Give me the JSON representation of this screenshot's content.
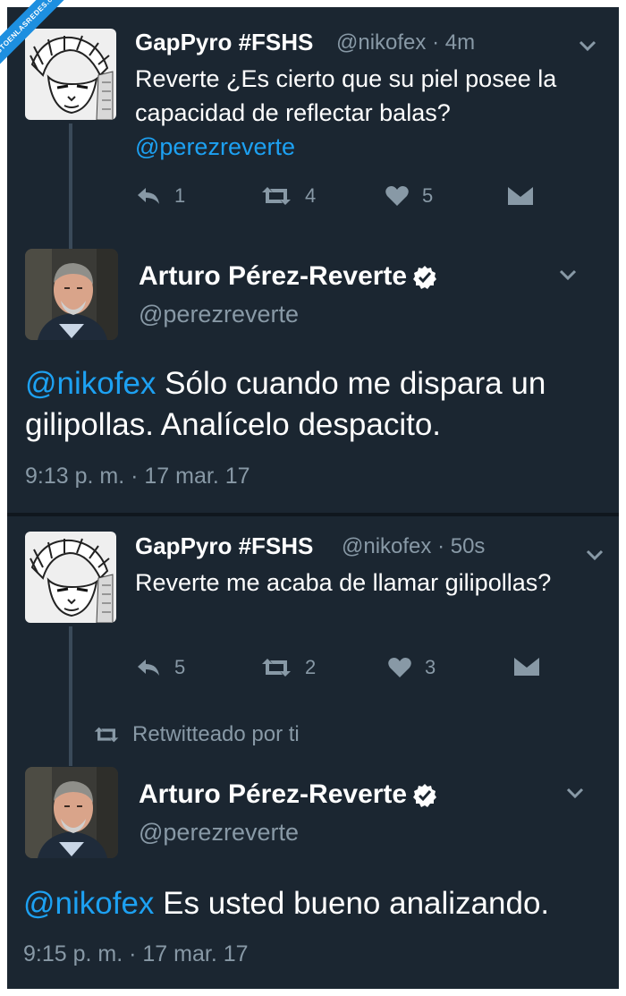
{
  "watermark": "VISTOENLASREDES.com",
  "tweet1": {
    "name": "GapPyro #FSHS",
    "handle": "@nikofex · 4m",
    "text": "Reverte ¿Es cierto que su piel posee la capacidad de reflectar balas?",
    "mention": "@perezreverte",
    "reply_count": "1",
    "retweet_count": "4",
    "like_count": "5"
  },
  "reply1": {
    "name": "Arturo Pérez-Reverte",
    "handle": "@perezreverte",
    "mention": "@nikofex",
    "text": " Sólo cuando me dispara un gilipollas. Analícelo despacito.",
    "timestamp": "9:13 p. m. · 17 mar. 17"
  },
  "tweet2": {
    "name": "GapPyro #FSHS",
    "handle": "@nikofex · 50s",
    "text": "Reverte me acaba de llamar gilipollas?",
    "reply_count": "5",
    "retweet_count": "2",
    "like_count": "3"
  },
  "retweet_banner": "Retwitteado por ti",
  "reply2": {
    "name": "Arturo Pérez-Reverte",
    "handle": "@perezreverte",
    "mention": "@nikofex",
    "text": " Es usted bueno analizando.",
    "timestamp": "9:15 p. m. · 17 mar. 17"
  },
  "colors": {
    "background": "#1b2631",
    "text": "#ffffff",
    "muted": "#8899a6",
    "link": "#1da1f2"
  },
  "icons": [
    "reply-icon",
    "retweet-icon",
    "like-icon",
    "dm-icon",
    "chevron-down-icon",
    "verified-badge-icon"
  ]
}
